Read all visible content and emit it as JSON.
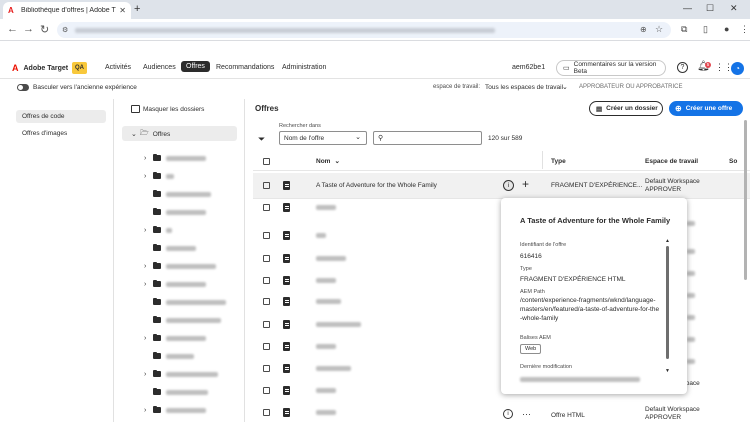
{
  "browser": {
    "tab_title": "Bibliothèque d'offres | Adobe T",
    "tab_close": "✕",
    "new_tab": "+",
    "win_min": "—",
    "win_max": "☐",
    "win_close": "✕"
  },
  "app": {
    "logo_text": "Adobe Target",
    "env_badge": "QA",
    "nav": [
      "Activités",
      "Audiences",
      "Offres",
      "Recommandations",
      "Administration"
    ],
    "active_nav": "Offres",
    "instance": "aem62be1",
    "beta_feedback": "Commentaires sur la version Beta",
    "notif_count": "5"
  },
  "subbar": {
    "toggle_label": "Basculer vers l'ancienne expérience",
    "workspace_label": "espace de travail:",
    "workspace_value": "Tous les espaces de travail",
    "role": "APPROBATEUR OU APPROBATRICE"
  },
  "left_nav": {
    "items": [
      "Offres de code",
      "Offres d'images"
    ]
  },
  "folders": {
    "hide_label": "Masquer les dossiers",
    "root": "Offres"
  },
  "main": {
    "title": "Offres",
    "create_folder": "Créer un dossier",
    "create_offer": "Créer une offre",
    "search_in_label": "Rechercher dans",
    "search_in_value": "Nom de l'offre",
    "count": "120 sur 589",
    "columns": {
      "name": "Nom",
      "type": "Type",
      "workspace": "Espace de travail",
      "extra": "So"
    }
  },
  "rows": [
    {
      "name": "A Taste of Adventure for the Whole Family",
      "type": "FRAGMENT D'EXPÉRIENCE...",
      "workspace": "Default Workspace",
      "role": "APPROVER"
    },
    {
      "type": "Offre HTML",
      "workspace": "Default Workspace",
      "role": "APPROVER"
    },
    {
      "type": "Offre HTML",
      "workspace": "Default Workspace",
      "role": "APPROVER"
    }
  ],
  "popover": {
    "title": "A Taste of Adventure for the Whole Family",
    "id_label": "Identifiant de l'offre",
    "id_value": "616416",
    "type_label": "Type",
    "type_value": "FRAGMENT D'EXPÉRIENCE HTML",
    "path_label": "AEM Path",
    "path_value": "/content/experience-fragments/wknd/language-masters/en/featured/a-taste-of-adventure-for-the-whole-family",
    "tags_label": "Balises AEM",
    "tag": "Web",
    "modified_label": "Dernière modification"
  },
  "colors": {
    "accent": "#1473e6",
    "adobe_red": "#eb1000",
    "qa_badge": "#f8c83b"
  }
}
